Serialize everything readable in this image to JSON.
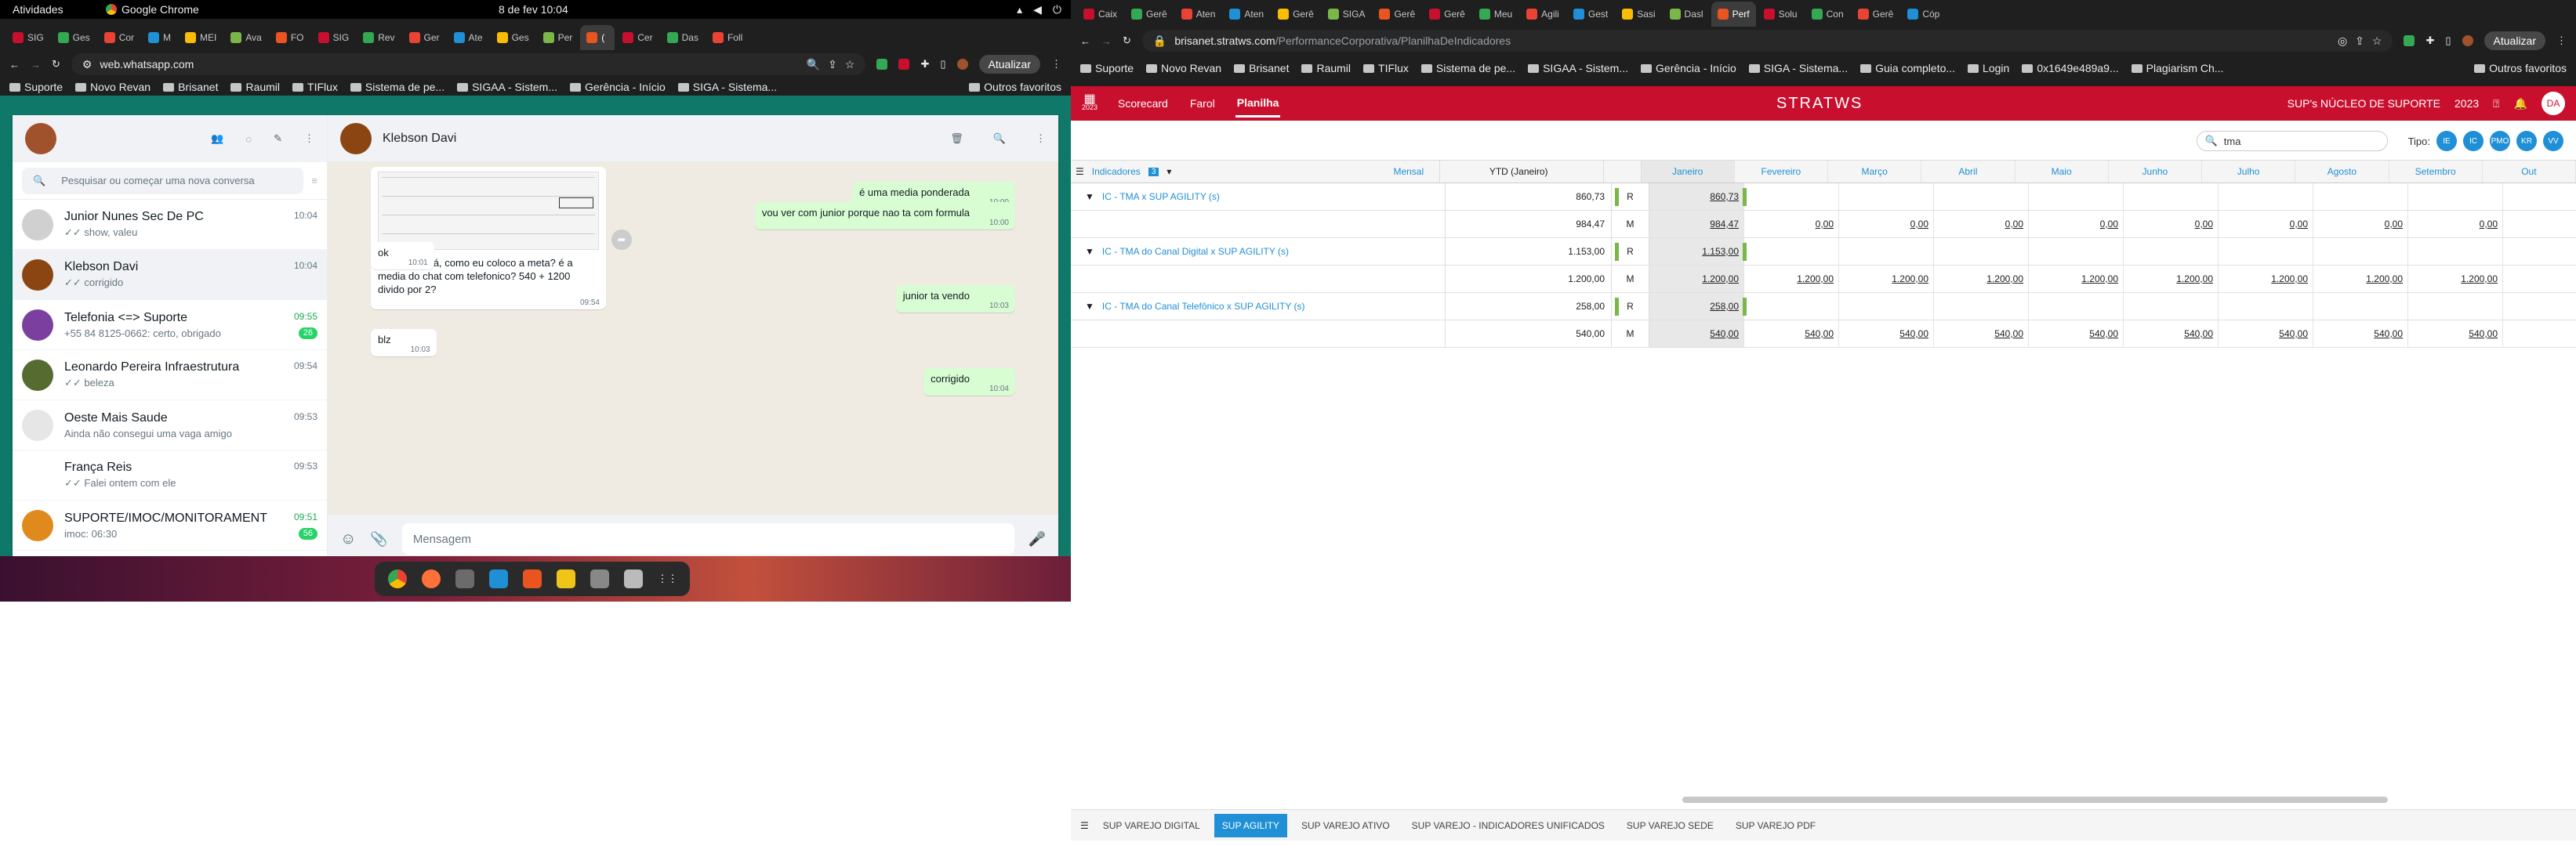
{
  "gnome": {
    "activities": "Atividades",
    "app": "Google Chrome",
    "clock": "8 de fev  10:04"
  },
  "left_browser": {
    "tabs": [
      "SIG",
      "Ges",
      "Cor",
      "M",
      "MEI",
      "Ava",
      "FO",
      "SIG",
      "Rev",
      "Ger",
      "Ate",
      "Ges",
      "Per",
      "(",
      "Cer",
      "Das",
      "Foll"
    ],
    "url": "web.whatsapp.com",
    "update_label": "Atualizar",
    "bookmarks": [
      "Suporte",
      "Novo Revan",
      "Brisanet",
      "Raumil",
      "TIFlux",
      "Sistema de pe...",
      "SIGAA - Sistem...",
      "Gerência - Início",
      "SIGA - Sistema..."
    ],
    "other_bookmarks": "Outros favoritos"
  },
  "whatsapp": {
    "search_placeholder": "Pesquisar ou começar uma nova conversa",
    "chats": [
      {
        "name": "Junior Nunes Sec De PC",
        "time": "10:04",
        "preview": "✓✓ show, valeu",
        "badge": ""
      },
      {
        "name": "Klebson Davi",
        "time": "10:04",
        "preview": "✓✓ corrigido",
        "badge": ""
      },
      {
        "name": "Telefonia <=> Suporte",
        "time": "09:55",
        "preview": "+55 84 8125-0662: certo, obrigado",
        "badge": "26"
      },
      {
        "name": "Leonardo Pereira Infraestrutura",
        "time": "09:54",
        "preview": "✓✓ beleza",
        "badge": ""
      },
      {
        "name": "Oeste Mais Saude",
        "time": "09:53",
        "preview": "Ainda não consegui uma vaga amigo",
        "badge": ""
      },
      {
        "name": "França Reis",
        "time": "09:53",
        "preview": "✓✓ Falei ontem com ele",
        "badge": ""
      },
      {
        "name": "SUPORTE/IMOC/MONITORAMENT",
        "time": "09:51",
        "preview": "imoc: 06:30",
        "badge": "56"
      }
    ],
    "contact": "Klebson Davi",
    "messages": [
      {
        "dir": "in",
        "text": "mas ai que tá, como eu coloco a meta? é a media do chat com telefonico? 540 + 1200 divido por 2?",
        "time": "09:54"
      },
      {
        "dir": "out",
        "text": "é uma media ponderada",
        "time": "10:00"
      },
      {
        "dir": "out",
        "text": "vou ver com junior porque nao ta com formula",
        "time": "10:00"
      },
      {
        "dir": "in",
        "text": "ok",
        "time": "10:01"
      },
      {
        "dir": "out",
        "text": "junior ta vendo",
        "time": "10:03"
      },
      {
        "dir": "in",
        "text": "blz",
        "time": "10:03"
      },
      {
        "dir": "out",
        "text": "corrigido",
        "time": "10:04"
      }
    ],
    "input_placeholder": "Mensagem"
  },
  "right_browser": {
    "tabs": [
      "Caix",
      "Gerê",
      "Aten",
      "Aten",
      "Gerê",
      "SIGA",
      "Gerê",
      "Gerê",
      "Meu",
      "Agili",
      "Gest",
      "Sasi",
      "Dasl",
      "Perf",
      "Solu",
      "Con",
      "Gerê",
      "Cóp"
    ],
    "url_host": "brisanet.stratws.com",
    "url_path": "/PerformanceCorporativa/PlanilhaDeIndicadores",
    "update_label": "Atualizar",
    "bookmarks": [
      "Suporte",
      "Novo Revan",
      "Brisanet",
      "Raumil",
      "TIFlux",
      "Sistema de pe...",
      "SIGAA - Sistem...",
      "Gerência - Início",
      "SIGA - Sistema...",
      "Guia completo...",
      "Login",
      "0x1649e489a9...",
      "Plagiarism Ch..."
    ],
    "other_bookmarks": "Outros favoritos"
  },
  "stratws": {
    "year_small": "2023",
    "nav": [
      "Scorecard",
      "Farol",
      "Planilha"
    ],
    "logo": "STRATWS",
    "unit": "SUP's NÚCLEO DE SUPORTE",
    "year": "2023",
    "user_initials": "DA",
    "search_value": "tma",
    "tipo_label": "Tipo:",
    "tipo_chips": [
      "IE",
      "IC",
      "PMO",
      "KR",
      "VV"
    ],
    "header": {
      "indicadores": "Indicadores",
      "count": "3",
      "periodo": "Mensal",
      "ytd": "YTD (Janeiro)",
      "months": [
        "Janeiro",
        "Fevereiro",
        "Março",
        "Abril",
        "Maio",
        "Junho",
        "Julho",
        "Agosto",
        "Setembro",
        "Out"
      ]
    },
    "rows": [
      {
        "name": "IC - TMA x SUP AGILITY (s)",
        "ytd_r": "860,73",
        "ytd_m": "984,47",
        "r": [
          "860,73",
          "",
          "",
          "",
          "",
          "",
          "",
          "",
          ""
        ],
        "m": [
          "984,47",
          "0,00",
          "0,00",
          "0,00",
          "0,00",
          "0,00",
          "0,00",
          "0,00",
          "0,00"
        ]
      },
      {
        "name": "IC - TMA do Canal Digital x SUP AGILITY (s)",
        "ytd_r": "1.153,00",
        "ytd_m": "1.200,00",
        "r": [
          "1.153,00",
          "",
          "",
          "",
          "",
          "",
          "",
          "",
          ""
        ],
        "m": [
          "1.200,00",
          "1.200,00",
          "1.200,00",
          "1.200,00",
          "1.200,00",
          "1.200,00",
          "1.200,00",
          "1.200,00",
          "1.200,00"
        ]
      },
      {
        "name": "IC - TMA do Canal Telefônico x SUP AGILITY (s)",
        "ytd_r": "258,00",
        "ytd_m": "540,00",
        "r": [
          "258,00",
          "",
          "",
          "",
          "",
          "",
          "",
          "",
          ""
        ],
        "m": [
          "540,00",
          "540,00",
          "540,00",
          "540,00",
          "540,00",
          "540,00",
          "540,00",
          "540,00",
          "540,00"
        ]
      }
    ],
    "bottom_tabs": [
      "SUP VAREJO DIGITAL",
      "SUP AGILITY",
      "SUP VAREJO ATIVO",
      "SUP VAREJO - INDICADORES UNIFICADOS",
      "SUP VAREJO SEDE",
      "SUP VAREJO PDF"
    ],
    "active_bottom_tab": "SUP AGILITY"
  },
  "colors": {
    "whatsapp_teal": "#0f7869",
    "stratws_red": "#c8102e",
    "link_blue": "#1f8fd6",
    "ok_green": "#7ab648"
  }
}
